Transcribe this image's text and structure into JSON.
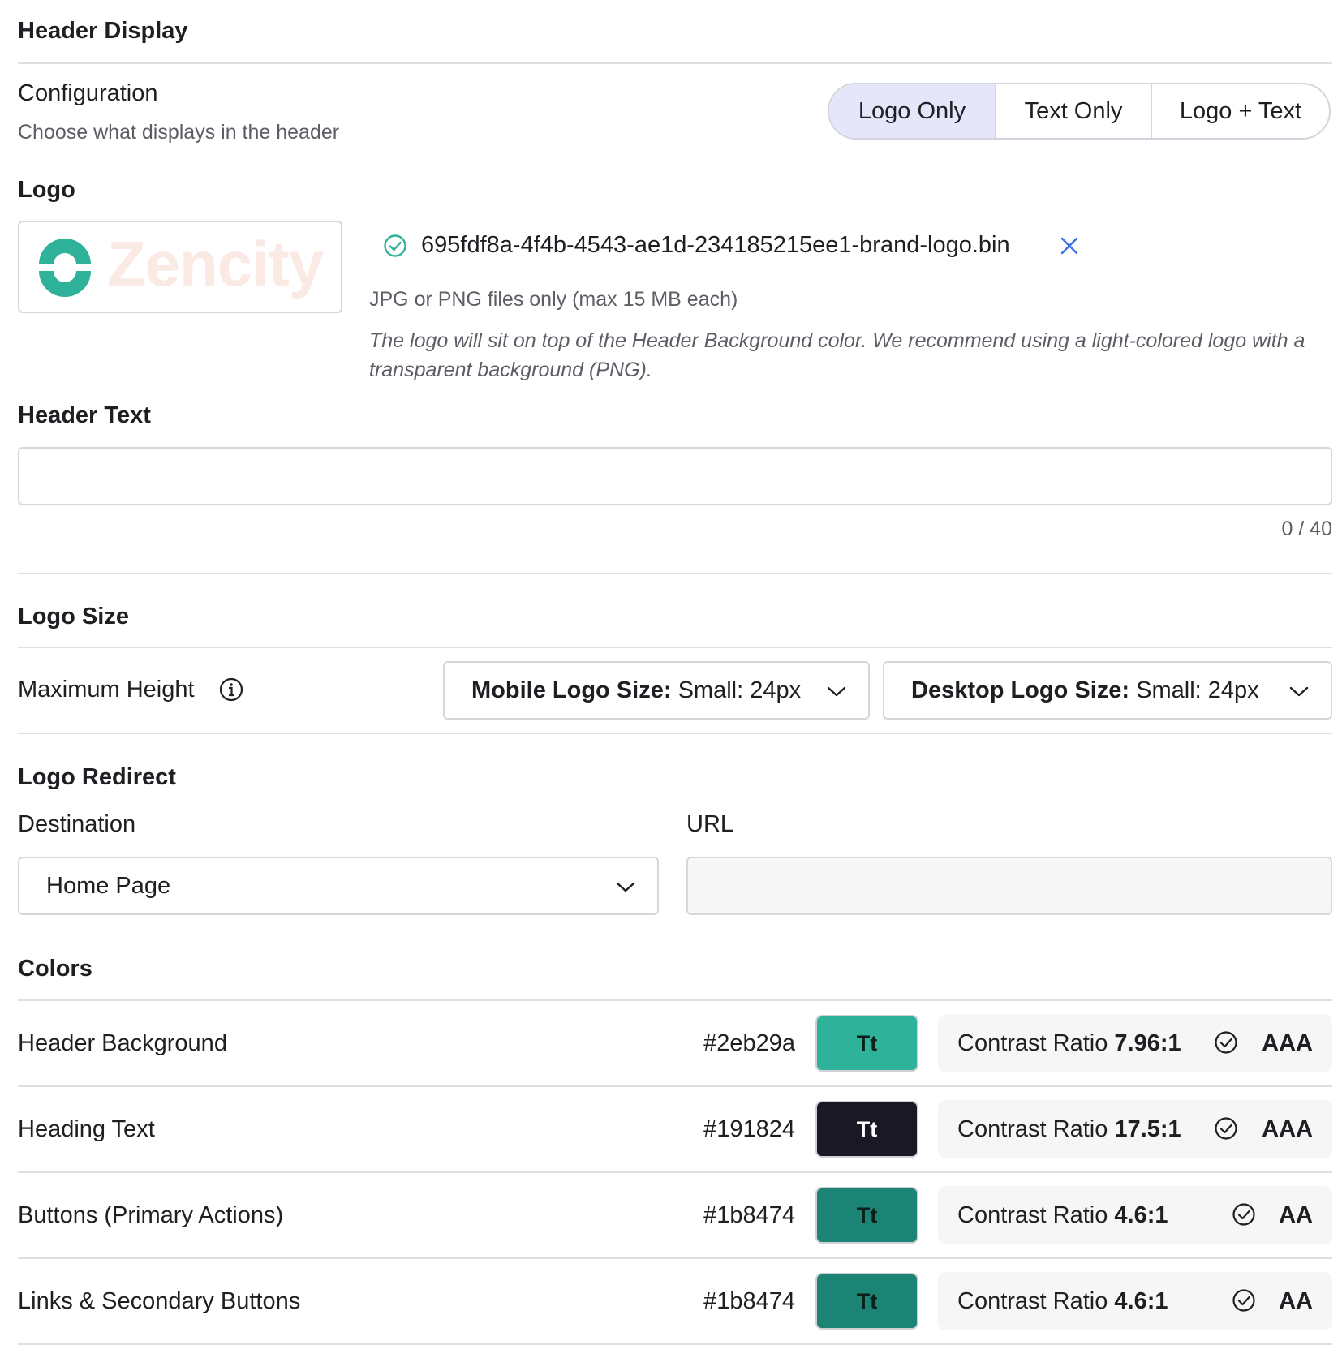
{
  "header_display": {
    "title": "Header Display",
    "configuration": {
      "label": "Configuration",
      "description": "Choose what displays in the header",
      "options": [
        "Logo Only",
        "Text Only",
        "Logo + Text"
      ],
      "selected": "Logo Only"
    }
  },
  "logo": {
    "title": "Logo",
    "preview_text": "Zencity",
    "file_name": "695fdf8a-4f4b-4543-ae1d-234185215ee1-brand-logo.bin",
    "file_hint": "JPG or PNG files only (max 15 MB each)",
    "note": "The logo will sit on top of the Header Background color. We recommend using a light-colored logo with a transparent background (PNG)."
  },
  "header_text": {
    "title": "Header Text",
    "value": "",
    "counter": "0 / 40"
  },
  "logo_size": {
    "title": "Logo Size",
    "label": "Maximum Height",
    "mobile": {
      "label": "Mobile Logo Size:",
      "value": "Small: 24px"
    },
    "desktop": {
      "label": "Desktop Logo Size:",
      "value": "Small: 24px"
    }
  },
  "logo_redirect": {
    "title": "Logo Redirect",
    "destination_label": "Destination",
    "destination_value": "Home Page",
    "url_label": "URL",
    "url_value": ""
  },
  "colors": {
    "title": "Colors",
    "swatch_text": "Tt",
    "contrast_prefix": "Contrast Ratio",
    "rows": [
      {
        "label": "Header Background",
        "hex": "#2eb29a",
        "text_color": "#0b1f1b",
        "ratio": "7.96:1",
        "grade": "AAA"
      },
      {
        "label": "Heading Text",
        "hex": "#191824",
        "text_color": "#ffffff",
        "ratio": "17.5:1",
        "grade": "AAA"
      },
      {
        "label": "Buttons (Primary Actions)",
        "hex": "#1b8474",
        "text_color": "#0b1f1b",
        "ratio": "4.6:1",
        "grade": "AA"
      },
      {
        "label": "Links & Secondary Buttons",
        "hex": "#1b8474",
        "text_color": "#0b1f1b",
        "ratio": "4.6:1",
        "grade": "AA"
      }
    ]
  },
  "theme": {
    "brand_teal": "#2eb29a",
    "segment_active_bg": "#e6e6fb",
    "success_icon": "#2eb29a",
    "remove_icon": "#3b6fe0"
  }
}
